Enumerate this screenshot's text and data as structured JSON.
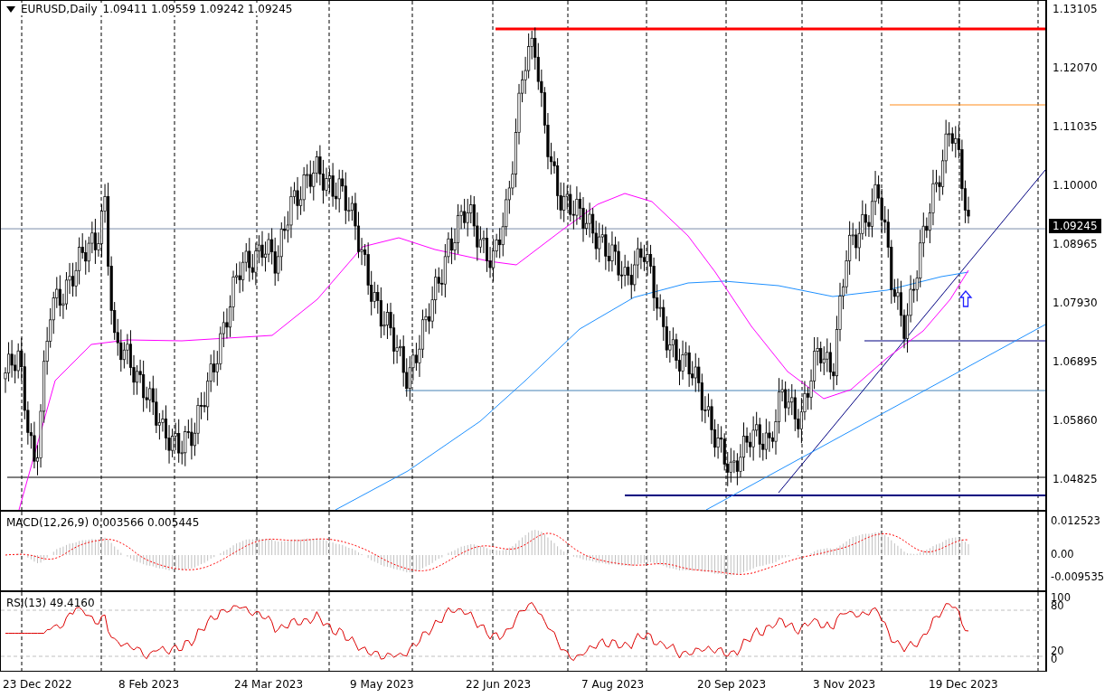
{
  "header": {
    "symbol": "EURUSD,Daily",
    "values": "1.09411 1.09559 1.09242 1.09245"
  },
  "price_axis": {
    "ticks": [
      "1.13105",
      "1.12070",
      "1.11035",
      "1.10000",
      "1.08965",
      "1.07930",
      "1.06895",
      "1.05860",
      "1.04825"
    ],
    "current_price": "1.09245"
  },
  "macd": {
    "label": "MACD(12,26,9) 0.003566 0.005445",
    "ticks": [
      "0.012523",
      "0.00",
      "-0.009535"
    ]
  },
  "rsi": {
    "label": "RSI(13) 49.4160",
    "ticks": [
      "100",
      "80",
      "20",
      "0"
    ]
  },
  "time_axis": {
    "ticks": [
      "23 Dec 2022",
      "8 Feb 2023",
      "24 Mar 2023",
      "9 May 2023",
      "22 Jun 2023",
      "7 Aug 2023",
      "20 Sep 2023",
      "3 Nov 2023",
      "19 Dec 2023"
    ]
  }
}
